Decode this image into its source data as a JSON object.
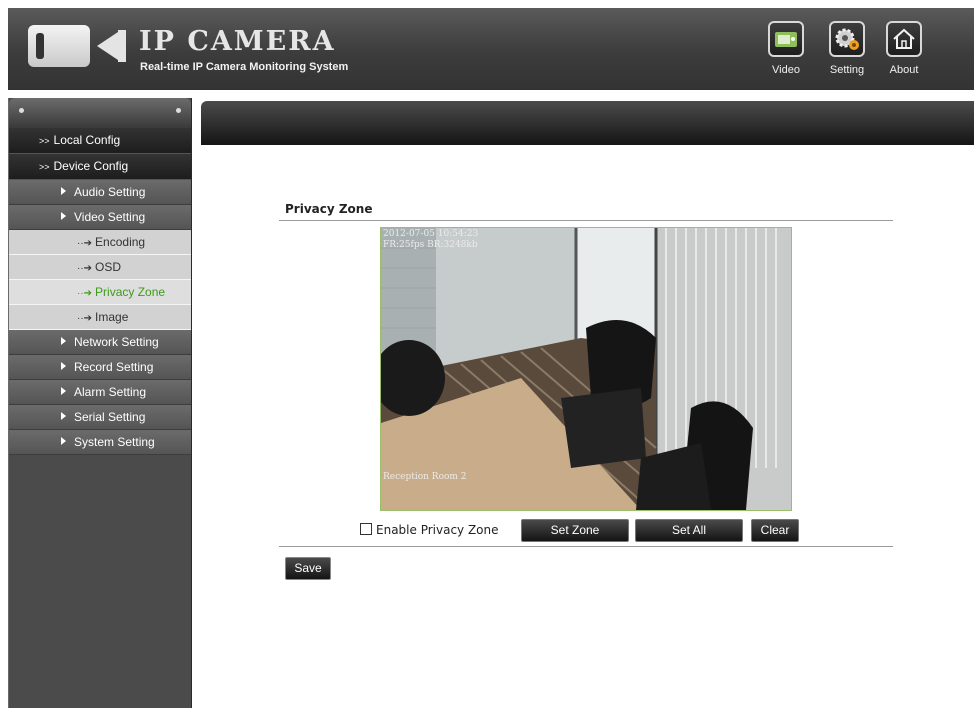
{
  "brand": {
    "title": "IP CAMERA",
    "subtitle": "Real-time IP Camera Monitoring System"
  },
  "nav": [
    {
      "label": "Video",
      "icon": "video-icon"
    },
    {
      "label": "Setting",
      "icon": "gear-icon"
    },
    {
      "label": "About",
      "icon": "home-icon"
    }
  ],
  "sidebar": {
    "groups": [
      "Local Config",
      "Device Config"
    ],
    "items": [
      {
        "label": "Audio Setting"
      },
      {
        "label": "Video Setting"
      },
      {
        "label": "Network Setting"
      },
      {
        "label": "Record Setting"
      },
      {
        "label": "Alarm Setting"
      },
      {
        "label": "Serial Setting"
      },
      {
        "label": "System Setting"
      }
    ],
    "video_subitems": [
      {
        "label": "Encoding"
      },
      {
        "label": "OSD"
      },
      {
        "label": "Privacy Zone",
        "active": true
      },
      {
        "label": "Image"
      }
    ],
    "active_color": "#3e9b1a"
  },
  "main": {
    "section_title": "Privacy Zone",
    "video": {
      "osd_timestamp": "2012-07-05 10:54:23",
      "osd_stats": "FR:25fps BR:3248kb",
      "osd_room": "Reception Room 2"
    },
    "enable_privacy_label": "Enable Privacy Zone",
    "enable_privacy_checked": false,
    "buttons": {
      "set_zone": "Set Zone",
      "set_all": "Set All",
      "clear": "Clear",
      "save": "Save"
    }
  }
}
